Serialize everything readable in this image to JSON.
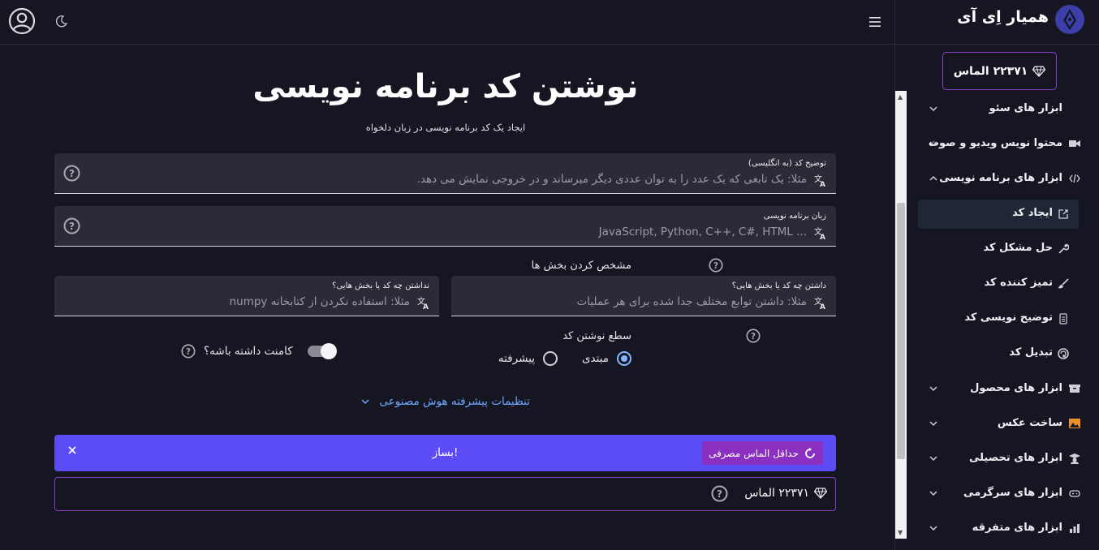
{
  "brand": {
    "name": "همیار اِی آی"
  },
  "balance": {
    "top_label": "۲۲۳۷۱ الماس",
    "bottom_label": "۲۲۳۷۱ الماس"
  },
  "sidebar": {
    "items": [
      {
        "label": "ابزار های سئو",
        "icon": "seo-icon"
      },
      {
        "label": "محتوا نویس ویدیو و صوت",
        "icon": "video-icon"
      },
      {
        "label": "ابزار های برنامه نویسی",
        "icon": "code-icon",
        "expanded": true
      },
      {
        "label": "ابزار های محصول",
        "icon": "box-icon"
      },
      {
        "label": "ساخت عکس",
        "icon": "image-icon"
      },
      {
        "label": "ابزار های تحصیلی",
        "icon": "graduation-icon"
      },
      {
        "label": "ابزار های سرگرمی",
        "icon": "gamepad-icon"
      },
      {
        "label": "ابزار های متفرقه",
        "icon": "chart-icon"
      }
    ],
    "subitems": [
      {
        "label": "ایجاد کد",
        "icon": "create-icon",
        "active": true
      },
      {
        "label": "حل مشکل کد",
        "icon": "wrench-icon"
      },
      {
        "label": "تمیز کننده کد",
        "icon": "brush-icon"
      },
      {
        "label": "توضیح نویسی کد",
        "icon": "document-icon"
      },
      {
        "label": "تبدیل کد",
        "icon": "convert-icon"
      }
    ]
  },
  "main": {
    "title": "نوشتن کد برنامه نویسی",
    "subtitle": "ایجاد یک کد برنامه نویسی در زبان دلخواه",
    "description_field": {
      "label": "توضیح کد (به انگلیسی)",
      "placeholder": "مثلا: یک تابعی که یک عدد را به توان عددی دیگر میرساند و در خروجی نمایش می دهد."
    },
    "language_field": {
      "label": "زبان برنامه نویسی",
      "placeholder": "JavaScript, Python, C++, C#, HTML ..."
    },
    "sections_label": "مشخص کردن بخش ها",
    "has_field": {
      "label": "داشتن چه کد یا بخش هایی؟",
      "placeholder": "مثلا: داشتن توابع مختلف  جدا شده برای هر عملیات"
    },
    "not_has_field": {
      "label": "نداشتن چه کد یا بخش هایی؟",
      "placeholder": "مثلا: استفاده نکردن از کتابخانه numpy"
    },
    "level_label": "سطع نوشتن کد",
    "level_options": [
      "مبتدی",
      "پیشرفته"
    ],
    "level_selected": "مبتدی",
    "comment_label": "کامنت داشته باشه؟",
    "comment_on": true,
    "advanced_label": "تنظیمات پیشرفته هوش مصنوعی",
    "build_label": "بساز!",
    "min_cost_label": "حداقل الماس مصرفی"
  },
  "colors": {
    "accent": "#5b4cf5",
    "border_purple": "#8b3ec8",
    "link_blue": "#6ea8ff",
    "bg": "#151621"
  }
}
